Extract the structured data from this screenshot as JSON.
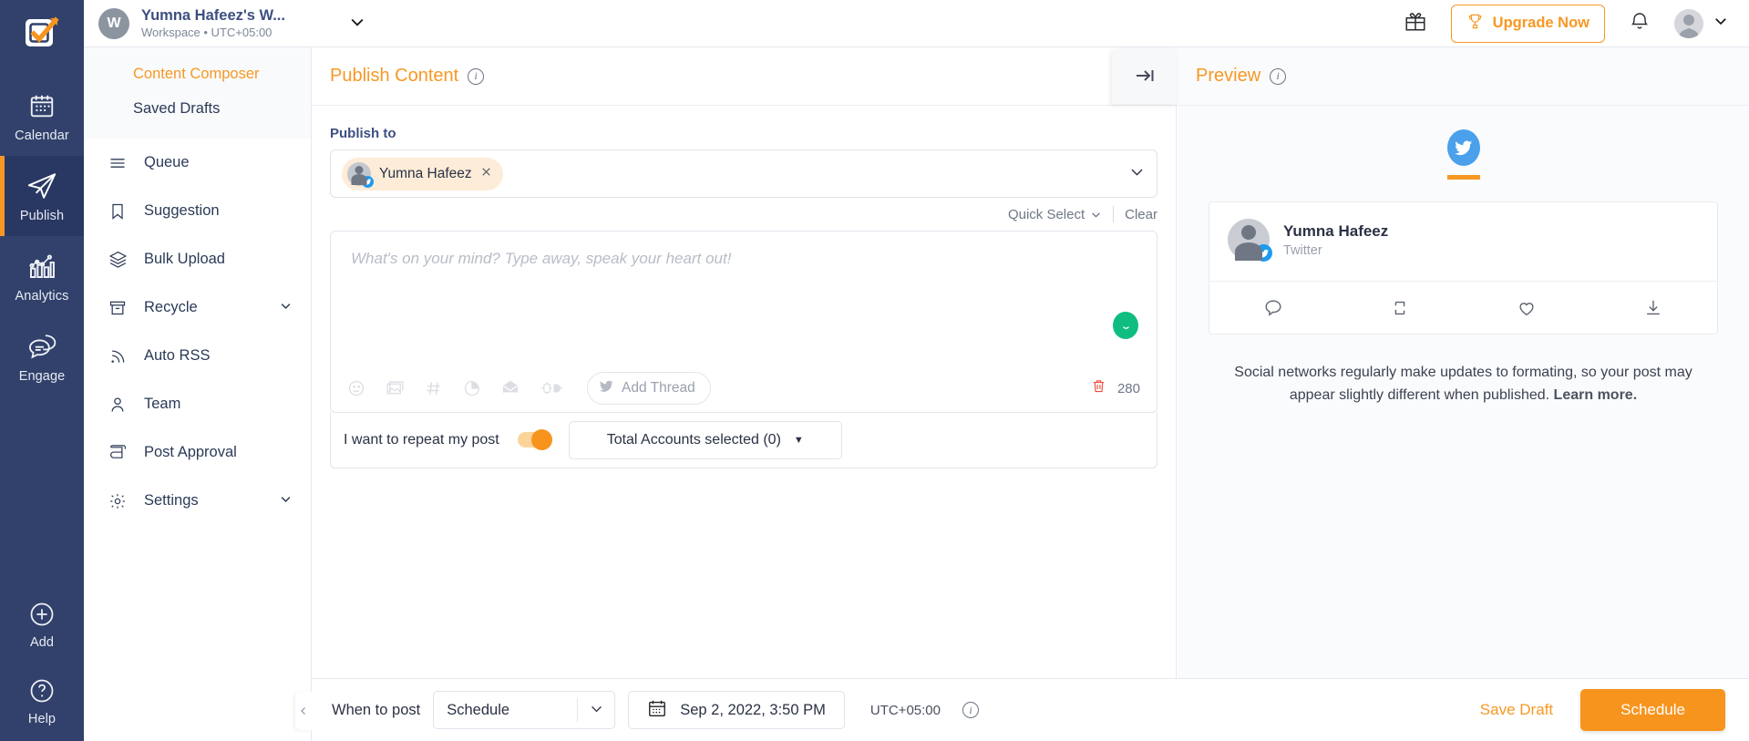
{
  "brand": {
    "accent": "#f79824",
    "navy": "#31416b",
    "twitter_blue": "#1d9bf0",
    "green": "#10bd81"
  },
  "rail": {
    "items": [
      {
        "label": "Calendar",
        "icon": "calendar-icon",
        "active": false
      },
      {
        "label": "Publish",
        "icon": "paper-plane-icon",
        "active": true
      },
      {
        "label": "Analytics",
        "icon": "bar-chart-icon",
        "active": false
      },
      {
        "label": "Engage",
        "icon": "chat-bubbles-icon",
        "active": false
      }
    ],
    "bottom": [
      {
        "label": "Add",
        "icon": "plus-circle-icon"
      },
      {
        "label": "Help",
        "icon": "question-circle-icon"
      }
    ]
  },
  "nav": {
    "header": {
      "label": "Publish Content",
      "icon": "pencil-icon",
      "caret": "chevron-up-icon"
    },
    "sub_items": [
      {
        "label": "Content Composer",
        "active": true
      },
      {
        "label": "Saved Drafts",
        "active": false
      }
    ],
    "items": [
      {
        "label": "Queue",
        "icon": "list-icon",
        "caret": false
      },
      {
        "label": "Suggestion",
        "icon": "bookmark-icon",
        "caret": false
      },
      {
        "label": "Bulk Upload",
        "icon": "layers-icon",
        "caret": false
      },
      {
        "label": "Recycle",
        "icon": "archive-icon",
        "caret": true
      },
      {
        "label": "Auto RSS",
        "icon": "rss-icon",
        "caret": false
      },
      {
        "label": "Team",
        "icon": "user-icon",
        "caret": false
      },
      {
        "label": "Post Approval",
        "icon": "scroll-icon",
        "caret": false
      },
      {
        "label": "Settings",
        "icon": "gear-icon",
        "caret": true
      }
    ]
  },
  "header": {
    "workspace_initial": "W",
    "workspace_name": "Yumna Hafeez's W...",
    "workspace_meta": "Workspace • UTC+05:00",
    "gift_icon": "gift-icon",
    "upgrade_label": "Upgrade Now",
    "upgrade_icon": "trophy-icon",
    "bell_icon": "bell-icon",
    "avatar_icon": "avatar",
    "avatar_caret": "chevron-down-icon"
  },
  "composer_panel": {
    "title": "Publish Content",
    "info_icon": "info-icon",
    "publish_to_label": "Publish to",
    "selected_accounts": [
      {
        "name": "Yumna Hafeez",
        "network": "twitter",
        "remove_icon": "close-icon"
      }
    ],
    "quick_select_label": "Quick Select",
    "clear_label": "Clear",
    "editor_placeholder": "What's on your mind? Type away, speak your heart out!",
    "editor_value": "",
    "toolbar_icons": [
      "emoji-icon",
      "image-icon",
      "hashtag-icon",
      "pie-chart-icon",
      "envelope-icon",
      "plug-icon"
    ],
    "add_thread_label": "Add Thread",
    "add_thread_icon": "twitter-bird-icon",
    "delete_icon": "trash-icon",
    "char_count": "280",
    "emoji_fab_icon": "smiley-icon",
    "repeat_label": "I want to repeat my post",
    "repeat_toggle_on": true,
    "accounts_select_label": "Total Accounts selected (0)",
    "accounts_select_caret": "caret-down-icon",
    "collapse_icon": "collapse-right-icon"
  },
  "preview_panel": {
    "title": "Preview",
    "info_icon": "info-icon",
    "networks": [
      {
        "name": "twitter",
        "icon": "twitter-bird-icon",
        "active": true
      }
    ],
    "card": {
      "author": "Yumna Hafeez",
      "network_label": "Twitter",
      "badge_icon": "twitter-bird-icon",
      "actions": [
        "reply-icon",
        "retweet-icon",
        "heart-icon",
        "share-icon"
      ]
    },
    "note_text": "Social networks regularly make updates to formating, so your post may appear slightly different when published.",
    "note_link": "Learn more."
  },
  "bottombar": {
    "when_to_post_label": "When to post",
    "schedule_mode": "Schedule",
    "schedule_mode_caret": "chevron-down-icon",
    "calendar_icon": "calendar-icon",
    "datetime": "Sep 2, 2022, 3:50 PM",
    "timezone": "UTC+05:00",
    "info_icon": "info-icon",
    "save_draft_label": "Save Draft",
    "schedule_button_label": "Schedule",
    "collapse_icon": "chevron-left-icon"
  }
}
